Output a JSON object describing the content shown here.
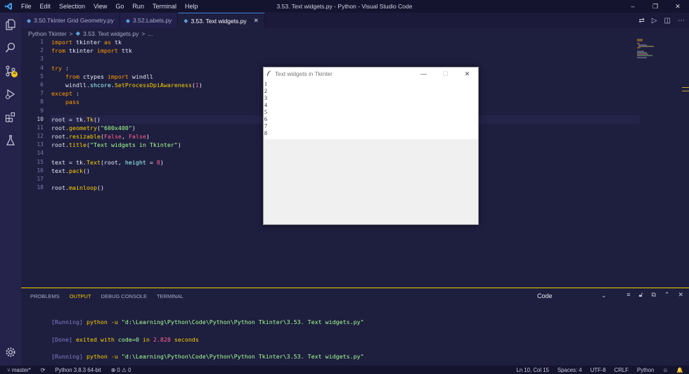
{
  "titlebar": {
    "logo": "vscode-logo",
    "menu": [
      "File",
      "Edit",
      "Selection",
      "View",
      "Go",
      "Run",
      "Terminal",
      "Help"
    ],
    "title": "3.53. Text widgets.py - Python - Visual Studio Code",
    "controls": [
      "–",
      "❐",
      "✕"
    ]
  },
  "activity": {
    "items": [
      "files-icon",
      "search-icon",
      "source-control-icon",
      "run-debug-icon",
      "extensions-icon",
      "testing-icon"
    ],
    "badge": "4",
    "bottom": "settings-gear-icon"
  },
  "tabs": [
    {
      "label": "3.50.Tkinter Grid Geometry.py",
      "active": false
    },
    {
      "label": "3.52.Labels.py",
      "active": false
    },
    {
      "label": "3.53. Text widgets.py",
      "active": true,
      "close": "✕"
    }
  ],
  "tab_actions": [
    "⇄",
    "▷",
    "◫",
    "⋯"
  ],
  "breadcrumb": {
    "folder": "Python Tkinter",
    "sep1": ">",
    "file": "3.53. Text widgets.py",
    "sep2": ">",
    "more": "..."
  },
  "editor": {
    "line_numbers": [
      "1",
      "2",
      "3",
      "4",
      "5",
      "6",
      "7",
      "8",
      "9",
      "10",
      "11",
      "12",
      "13",
      "14",
      "15",
      "16",
      "17",
      "18"
    ],
    "current_line": 10,
    "lines": [
      [
        {
          "t": "import",
          "c": "kw"
        },
        {
          "t": " tkinter ",
          "c": ""
        },
        {
          "t": "as",
          "c": "kw"
        },
        {
          "t": " tk",
          "c": ""
        }
      ],
      [
        {
          "t": "from",
          "c": "kw"
        },
        {
          "t": " tkinter ",
          "c": ""
        },
        {
          "t": "import",
          "c": "kw"
        },
        {
          "t": " ttk",
          "c": ""
        }
      ],
      [],
      [
        {
          "t": "try",
          "c": "kw"
        },
        {
          "t": " :",
          "c": ""
        }
      ],
      [
        {
          "t": "    ",
          "c": ""
        },
        {
          "t": "from",
          "c": "kw"
        },
        {
          "t": " ctypes ",
          "c": ""
        },
        {
          "t": "import",
          "c": "kw"
        },
        {
          "t": " windll",
          "c": ""
        }
      ],
      [
        {
          "t": "    windll.",
          "c": ""
        },
        {
          "t": "shcore",
          "c": "attr"
        },
        {
          "t": ".",
          "c": ""
        },
        {
          "t": "SetProcessDpiAwareness",
          "c": "fn"
        },
        {
          "t": "(",
          "c": ""
        },
        {
          "t": "1",
          "c": "num"
        },
        {
          "t": ")",
          "c": ""
        }
      ],
      [
        {
          "t": "except",
          "c": "kw"
        },
        {
          "t": " :",
          "c": ""
        }
      ],
      [
        {
          "t": "    ",
          "c": ""
        },
        {
          "t": "pass",
          "c": "kw"
        }
      ],
      [],
      [
        {
          "t": "root = tk.",
          "c": ""
        },
        {
          "t": "Tk",
          "c": "fn"
        },
        {
          "t": "()",
          "c": ""
        }
      ],
      [
        {
          "t": "root.",
          "c": ""
        },
        {
          "t": "geometry",
          "c": "fn"
        },
        {
          "t": "(",
          "c": ""
        },
        {
          "t": "\"600x400\"",
          "c": "str"
        },
        {
          "t": ")",
          "c": ""
        }
      ],
      [
        {
          "t": "root.",
          "c": ""
        },
        {
          "t": "resizable",
          "c": "fn"
        },
        {
          "t": "(",
          "c": ""
        },
        {
          "t": "False",
          "c": "num"
        },
        {
          "t": ", ",
          "c": ""
        },
        {
          "t": "False",
          "c": "num"
        },
        {
          "t": ")",
          "c": ""
        }
      ],
      [
        {
          "t": "root.",
          "c": ""
        },
        {
          "t": "title",
          "c": "fn"
        },
        {
          "t": "(",
          "c": ""
        },
        {
          "t": "\"Text widgets in Tkinter\"",
          "c": "str"
        },
        {
          "t": ")",
          "c": ""
        }
      ],
      [],
      [
        {
          "t": "text = tk.",
          "c": ""
        },
        {
          "t": "Text",
          "c": "fn"
        },
        {
          "t": "(root, ",
          "c": ""
        },
        {
          "t": "height",
          "c": "attr"
        },
        {
          "t": " = ",
          "c": ""
        },
        {
          "t": "8",
          "c": "num"
        },
        {
          "t": ")",
          "c": ""
        }
      ],
      [
        {
          "t": "text.",
          "c": ""
        },
        {
          "t": "pack",
          "c": "fn"
        },
        {
          "t": "()",
          "c": ""
        }
      ],
      [],
      [
        {
          "t": "root.",
          "c": ""
        },
        {
          "t": "mainloop",
          "c": "fn"
        },
        {
          "t": "()",
          "c": ""
        }
      ]
    ]
  },
  "tk_window": {
    "title": "Text widgets in Tkinter",
    "controls": [
      "—",
      "☐",
      "✕"
    ],
    "text_lines": [
      "1",
      "2",
      "3",
      "4",
      "5",
      "6",
      "7",
      "8"
    ]
  },
  "panel": {
    "tabs": [
      "PROBLEMS",
      "OUTPUT",
      "DEBUG CONSOLE",
      "TERMINAL"
    ],
    "active_tab": "OUTPUT",
    "selected_output": "Code",
    "icons": [
      "list-filter-icon",
      "lock-icon",
      "copy-icon",
      "chevron-up-icon",
      "close-icon"
    ],
    "output": {
      "run1_tag": "[Running]",
      "run1_cmd": " python -u ",
      "run1_path": "\"d:\\Learning\\Python\\Code\\Python\\Python Tkinter\\3.53. Text widgets.py\"",
      "done_tag": "[Done]",
      "done_text": " exited with ",
      "done_code": "code=0",
      "done_in": " in ",
      "done_time": "2.828",
      "done_sec": " seconds",
      "run2_tag": "[Running]",
      "run2_cmd": " python -u ",
      "run2_path": "\"d:\\Learning\\Python\\Code\\Python\\Python Tkinter\\3.53. Text widgets.py\""
    }
  },
  "statusbar": {
    "branch": "master*",
    "sync": "⟳",
    "interpreter": "Python 3.8.3 64-bit",
    "problems": "⊗ 0 ⚠ 0",
    "position": "Ln 10, Col 15",
    "spaces": "Spaces: 4",
    "encoding": "UTF-8",
    "eol": "CRLF",
    "language": "Python",
    "feedback": "☺",
    "bell": "🔔"
  },
  "colors": {
    "bg": "#1e1e3f",
    "accent": "#fad000",
    "keyword": "#ff9d00",
    "string": "#a5ff90",
    "number": "#ff628c"
  }
}
